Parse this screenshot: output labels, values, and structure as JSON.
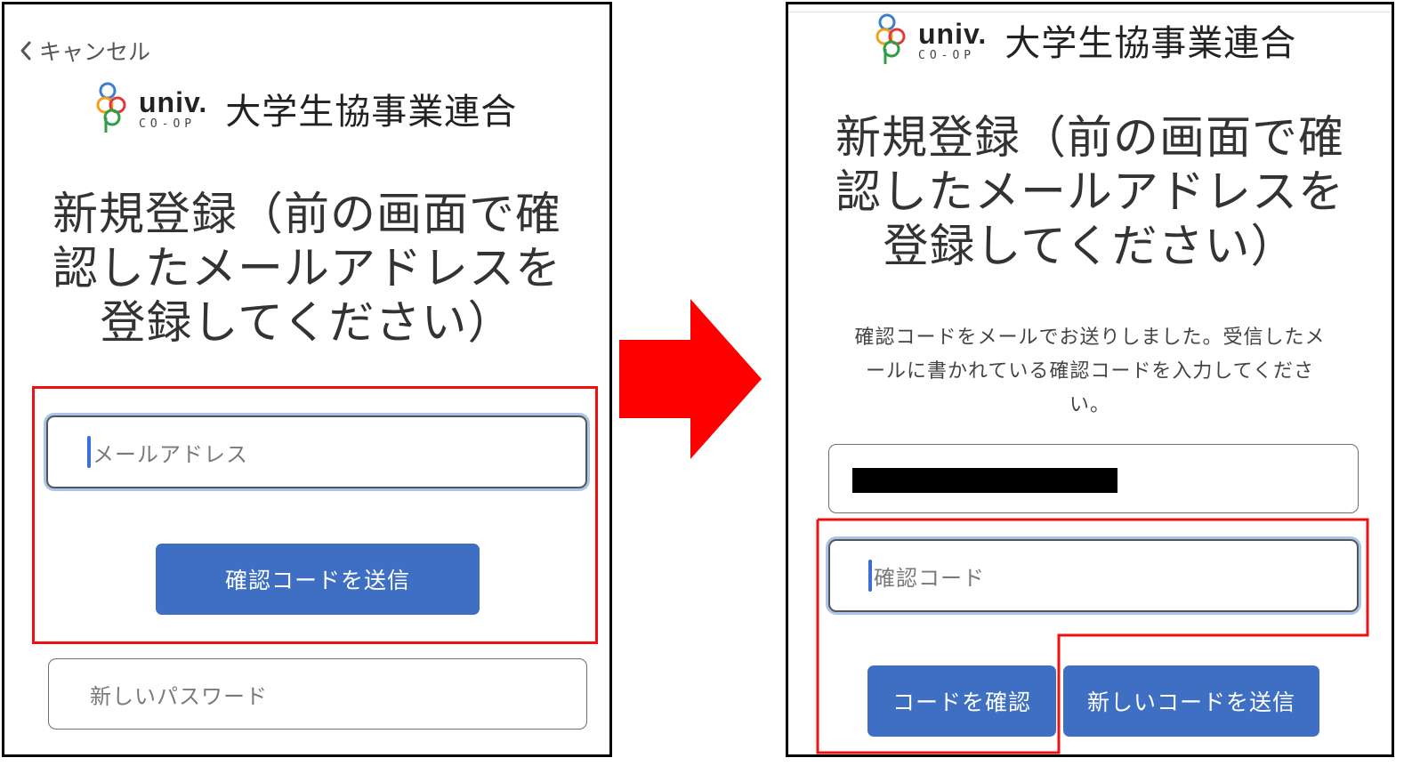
{
  "left_screen": {
    "back_label": "キャンセル",
    "logo": {
      "univ": "univ.",
      "coop": "CO-OP",
      "org": "大学生協事業連合"
    },
    "title_lines": [
      "新規登録（前の画面で確",
      "認したメールアドレスを",
      "登録してください）"
    ],
    "email_placeholder": "メールアドレス",
    "send_code_button": "確認コードを送信",
    "password_placeholder": "新しいパスワード"
  },
  "right_screen": {
    "logo": {
      "univ": "univ.",
      "coop": "CO-OP",
      "org": "大学生協事業連合"
    },
    "title_lines": [
      "新規登録（前の画面で確",
      "認したメールアドレスを",
      "登録してください）"
    ],
    "description_lines": [
      "確認コードをメールでお送りしました。受信したメ",
      "ールに書かれている確認コードを入力してくださ",
      "い。"
    ],
    "code_placeholder": "確認コード",
    "verify_button": "コードを確認",
    "resend_button": "新しいコードを送信"
  },
  "colors": {
    "button_blue": "#3f6fc2",
    "highlight_red": "#ee1111",
    "arrow_red": "#ff0000",
    "focus_ring": "#a8c4ea"
  },
  "icons": [
    "chevron-left-icon",
    "coop-logo-mark",
    "right-arrow"
  ]
}
